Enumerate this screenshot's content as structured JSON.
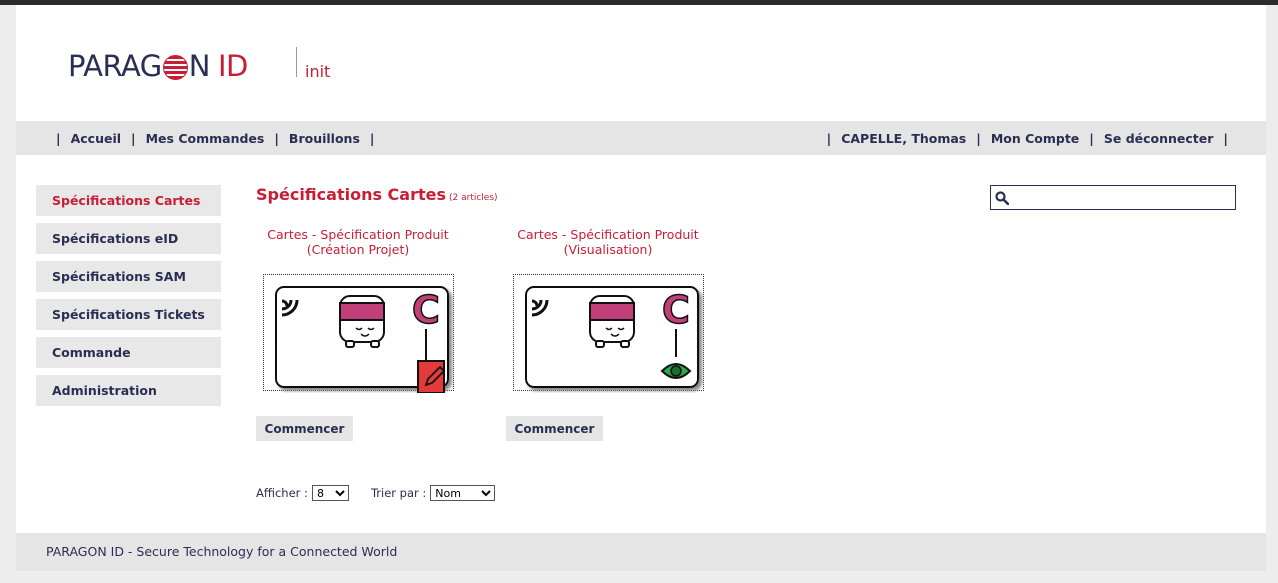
{
  "header": {
    "logo_text_main": "PARAGON",
    "logo_text_id": "ID",
    "env_label": "init"
  },
  "nav": {
    "left": [
      "Accueil",
      "Mes Commandes",
      "Brouillons"
    ],
    "right": [
      "CAPELLE, Thomas",
      "Mon Compte",
      "Se déconnecter"
    ]
  },
  "sidebar": {
    "items": [
      {
        "label": "Spécifications Cartes",
        "active": true
      },
      {
        "label": "Spécifications eID",
        "active": false
      },
      {
        "label": "Spécifications SAM",
        "active": false
      },
      {
        "label": "Spécifications Tickets",
        "active": false
      },
      {
        "label": "Commande",
        "active": false
      },
      {
        "label": "Administration",
        "active": false
      }
    ]
  },
  "main": {
    "title": "Spécifications Cartes",
    "count": "(2 articles)",
    "search": {
      "value": "",
      "icon": "search-icon"
    },
    "products": [
      {
        "title_line1": "Cartes - Spécification Produit",
        "title_line2": "(Création Projet)",
        "badge_icon": "edit-icon",
        "button": "Commencer"
      },
      {
        "title_line1": "Cartes - Spécification Produit",
        "title_line2": "(Visualisation)",
        "badge_icon": "eye-icon",
        "button": "Commencer"
      }
    ],
    "controls": {
      "show_label": "Afficher :",
      "show_value": "8",
      "sort_label": "Trier par :",
      "sort_value": "Nom"
    }
  },
  "footer": {
    "text": "PARAGON ID - Secure Technology for a Connected World"
  },
  "colors": {
    "brand_red": "#c81e35",
    "navy": "#2a2e52",
    "bar_gray": "#e5e5e5",
    "magenta": "#c2407a"
  }
}
